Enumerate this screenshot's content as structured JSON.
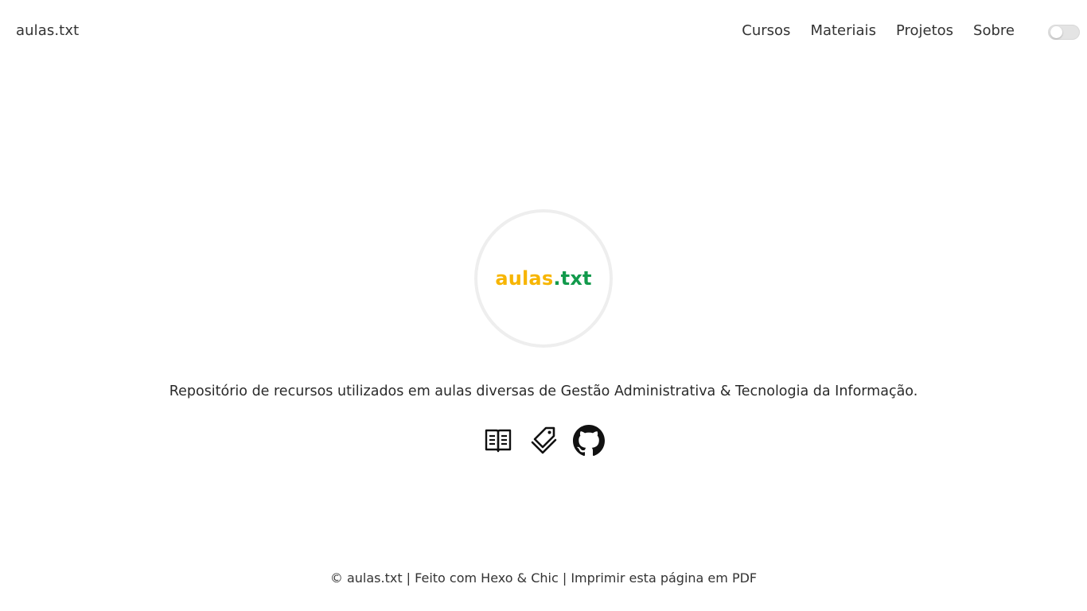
{
  "header": {
    "site_title": "aulas.txt",
    "nav": [
      {
        "label": "Cursos"
      },
      {
        "label": "Materiais"
      },
      {
        "label": "Projetos"
      },
      {
        "label": "Sobre"
      }
    ],
    "theme_toggle": {
      "state": "off"
    }
  },
  "hero": {
    "logo_part1": "aulas",
    "logo_part2": ".txt",
    "logo_colors": {
      "part1": "#f7b500",
      "part2": "#129a4c"
    },
    "description": "Repositório de recursos utilizados em aulas diversas de Gestão Administrativa & Tecnologia da Informação.",
    "icons": [
      {
        "name": "book-icon"
      },
      {
        "name": "tag-icon"
      },
      {
        "name": "github-icon"
      }
    ]
  },
  "footer": {
    "copyright": "© aulas.txt",
    "separator1": " | ",
    "made_with": "Feito com Hexo & Chic",
    "separator2": " | ",
    "print_pdf": "Imprimir esta página em PDF"
  }
}
